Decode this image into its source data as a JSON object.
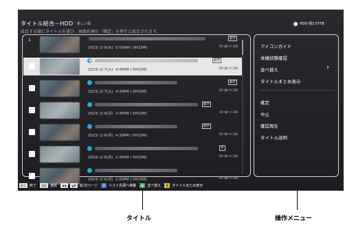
{
  "header": {
    "title": "タイトル結合－HDD",
    "subtitle": "新しい順",
    "instruction": "結合する順にタイトルを選び、画面右側の「確定」を押すと結合されます。",
    "record_info": "HDD 残3.57TB"
  },
  "list": {
    "selected_number": "1",
    "rows": [
      {
        "date": "2023/ 2/ 8(水)  0:00AM ( 0H15M)",
        "tag": "解字",
        "spec": "DR 解ﾁ 0.30B",
        "icon": "none"
      },
      {
        "date": "2023/ 2/ 7(火)  4:45PM ( 0H15M)",
        "tag": "解字",
        "spec": "DR 解ﾁ 0.30B",
        "icon": "half"
      },
      {
        "date": "2023/ 2/ 7(火)  4:30PM ( 0H15M)",
        "tag": "解字",
        "spec": "DR 解ﾁ 0.30B",
        "icon": "full"
      },
      {
        "date": "2023/ 2/ 6(月)  4:45PM ( 0H15M)",
        "tag": "解字",
        "spec": "DR 解ﾁ 0.30B",
        "icon": "full"
      },
      {
        "date": "2023/ 2/ 6(月)  4:30PM ( 0H15M)",
        "tag": "解字",
        "spec": "DR 解ﾁ 0.30B",
        "icon": "full"
      },
      {
        "date": "2023/ 2/ 6(月)  2:45PM ( 0H15M)",
        "tag": "字",
        "spec": "DR 解ﾁ 0.30B",
        "icon": "full"
      },
      {
        "date": "2023/ 2/ 6(月)  2:00PM ( 0H15M)",
        "tag": "",
        "spec": "DR 解ﾁ 0.30B",
        "icon": "full"
      }
    ]
  },
  "menu": {
    "items_top": [
      "アイコンガイド",
      "本機状態確認",
      "並べ替え",
      "タイトルまとめ表示"
    ],
    "items_bottom": [
      "確定",
      "中止",
      "確認再生",
      "タイトル説明"
    ],
    "arrow": "›"
  },
  "guide": [
    {
      "key": "戻る",
      "label": "終了",
      "color": "white"
    },
    {
      "key": "決定",
      "label": "選択",
      "color": "white"
    },
    {
      "key": "◀ ▶",
      "label": "",
      "color": "white"
    },
    {
      "key": "▲▼",
      "label": "前/次ページ",
      "color": "white"
    },
    {
      "key": "青",
      "label": "リスト先頭へ移動",
      "color": "blue"
    },
    {
      "key": "緑",
      "label": "並べ替え",
      "color": "green"
    },
    {
      "key": "黄",
      "label": "タイトルまとめ表示",
      "color": "yellow"
    }
  ],
  "callouts": {
    "left": "タイトル",
    "right": "操作メニュー"
  }
}
